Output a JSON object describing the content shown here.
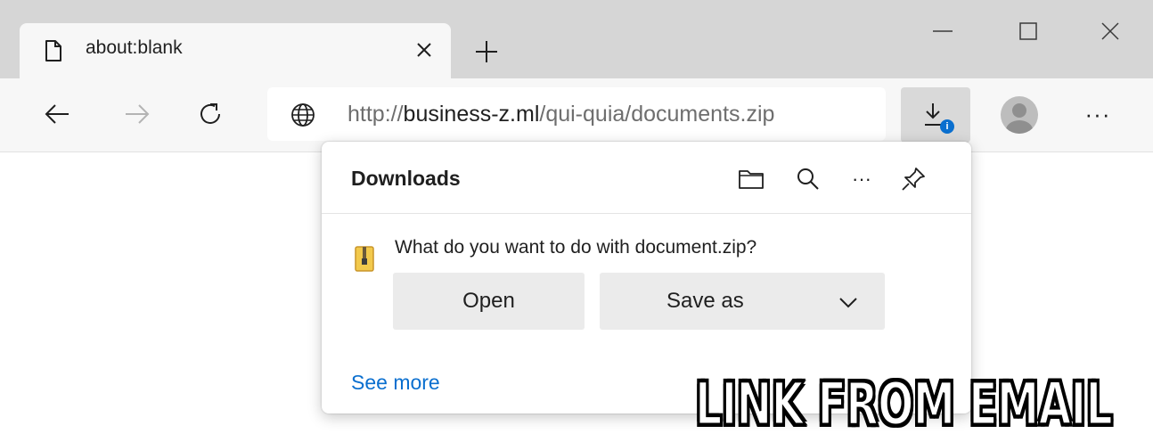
{
  "tab": {
    "title": "about:blank",
    "close_icon": "close-icon",
    "page_icon": "document-icon"
  },
  "window_controls": [
    "minimize",
    "maximize",
    "close"
  ],
  "toolbar": {
    "back_icon": "back-arrow-icon",
    "forward_icon": "forward-arrow-icon",
    "refresh_icon": "refresh-icon",
    "site_icon": "globe-icon",
    "url_scheme": "http://",
    "url_host": "business-z.ml",
    "url_path": "/qui-quia/documents.zip",
    "downloads_icon": "download-icon",
    "downloads_badge": "i",
    "profile_icon": "avatar",
    "menu_label": "···"
  },
  "downloads": {
    "title": "Downloads",
    "header_icons": [
      "folder-icon",
      "search-icon",
      "more-icon",
      "pin-icon"
    ],
    "more_label": "···",
    "question": "What do you want to do with document.zip?",
    "open_label": "Open",
    "save_as_label": "Save as",
    "see_more_label": "See more"
  },
  "caption": "LINK FROM EMAIL",
  "colors": {
    "tabstrip": "#d6d6d6",
    "toolbar": "#f7f7f7",
    "accent": "#0a6fcf",
    "button": "#ebebeb"
  }
}
